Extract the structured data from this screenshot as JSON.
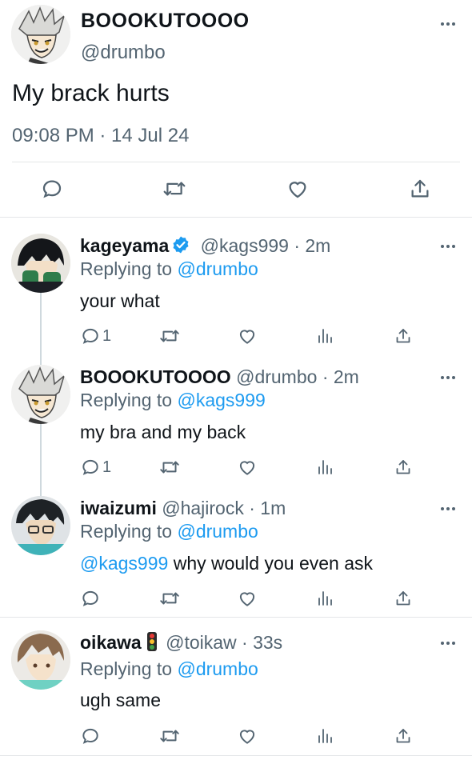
{
  "main_tweet": {
    "name": "BOOOKUTOOOO",
    "handle": "@drumbo",
    "text": "My brack hurts",
    "timestamp": "09:08 PM · 14 Jul 24",
    "actions": [
      "reply-icon",
      "retweet-icon",
      "like-icon",
      "share-icon"
    ]
  },
  "replies": [
    {
      "name": "kageyama",
      "verified": true,
      "handle": "@kags999",
      "time": "· 2m",
      "replying_label": "Replying to",
      "replying_to": "@drumbo",
      "mention": "",
      "text": "your what",
      "reply_count": "1"
    },
    {
      "name": "BOOOKUTOOOO",
      "verified": false,
      "handle": "@drumbo",
      "time": "· 2m",
      "replying_label": "Replying to",
      "replying_to": "@kags999",
      "mention": "",
      "text": "my bra and my back",
      "reply_count": "1"
    },
    {
      "name": "iwaizumi",
      "verified": false,
      "handle": "@hajirock",
      "time": "· 1m",
      "replying_label": "Replying to",
      "replying_to": "@drumbo",
      "mention": "@kags999",
      "text": " why would you even ask",
      "reply_count": ""
    },
    {
      "name": "oikawa",
      "verified": false,
      "emoji": "traffic-light-icon",
      "handle": "@toikaw",
      "time": "· 33s",
      "replying_label": "Replying to",
      "replying_to": "@drumbo",
      "mention": "",
      "text": "ugh same",
      "reply_count": ""
    }
  ],
  "colors": {
    "link": "#1d9bf0",
    "secondary": "#536471",
    "verified": "#1d9bf0",
    "divider": "#e3e6e8"
  }
}
